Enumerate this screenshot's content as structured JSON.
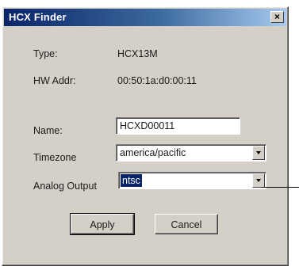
{
  "window": {
    "title": "HCX Finder",
    "close_label": "×"
  },
  "info": {
    "type_label": "Type:",
    "type_value": "HCX13M",
    "hw_label": "HW Addr:",
    "hw_value": "00:50:1a:d0:00:11"
  },
  "form": {
    "name_label": "Name:",
    "name_value": "HCXD00011",
    "timezone_label": "Timezone",
    "timezone_value": "america/pacific",
    "analog_label": "Analog Output",
    "analog_value": "ntsc"
  },
  "buttons": {
    "apply": "Apply",
    "cancel": "Cancel"
  }
}
